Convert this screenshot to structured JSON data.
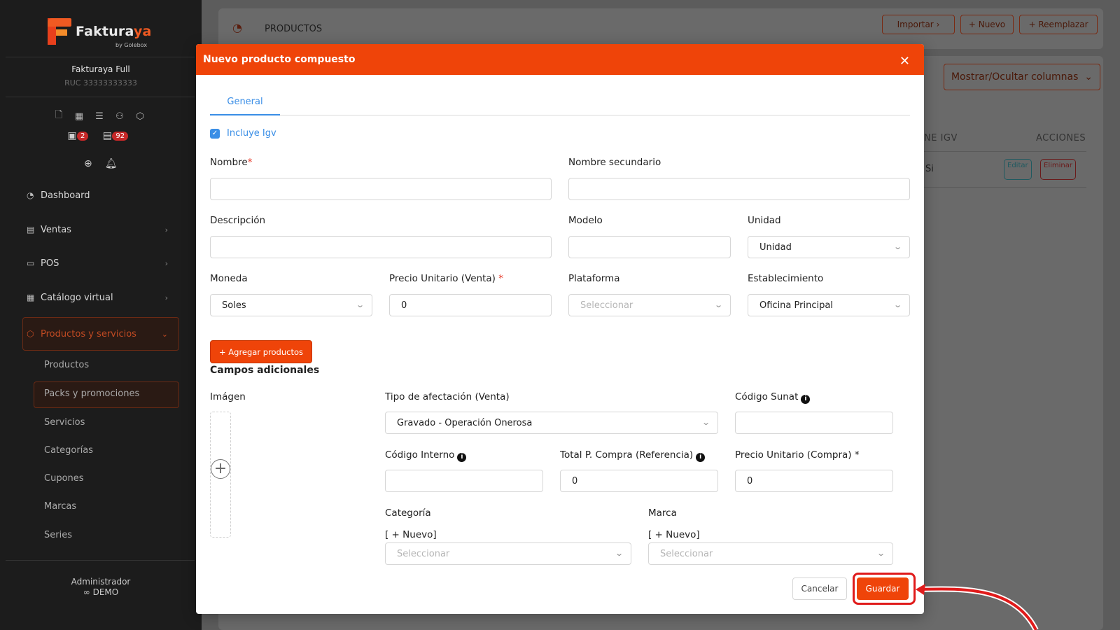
{
  "brand": {
    "name_part1": "Faktura",
    "name_part2": "ya",
    "sub": "by Golebox"
  },
  "company": {
    "name": "Fakturaya Full",
    "ruc": "RUC 33333333333"
  },
  "badges": {
    "calendar_count": "2",
    "boxes_count": "92"
  },
  "nav": {
    "dashboard": "Dashboard",
    "ventas": "Ventas",
    "pos": "POS",
    "catalogo": "Catálogo virtual",
    "productos_servicios": "Productos y servicios",
    "sub": {
      "productos": "Productos",
      "packs": "Packs y promociones",
      "servicios": "Servicios",
      "categorias": "Categorías",
      "cupones": "Cupones",
      "marcas": "Marcas",
      "series": "Series"
    }
  },
  "user": {
    "role": "Administrador",
    "mode": "DEMO"
  },
  "page": {
    "title": "PRODUCTOS",
    "import_label": "Importar",
    "new_label": "+ Nuevo",
    "replace_label": "+ Reemplazar",
    "toggle_columns_label": "Mostrar/Ocultar columnas",
    "th_igv": "NE IGV",
    "th_actions": "ACCIONES",
    "row_igv": "Si",
    "edit_label": "Editar",
    "delete_label": "Eliminar"
  },
  "modal": {
    "title": "Nuevo producto compuesto",
    "tab_general": "General",
    "includes_igv": "Incluye Igv",
    "nombre_label": "Nombre",
    "nombre_sec_label": "Nombre secundario",
    "descripcion_label": "Descripción",
    "modelo_label": "Modelo",
    "unidad_label": "Unidad",
    "unidad_value": "Unidad",
    "moneda_label": "Moneda",
    "moneda_value": "Soles",
    "precio_venta_label": "Precio Unitario (Venta)",
    "precio_venta_value": "0",
    "plataforma_label": "Plataforma",
    "plataforma_placeholder": "Seleccionar",
    "establecimiento_label": "Establecimiento",
    "establecimiento_value": "Oficina Principal",
    "add_products_label": "+ Agregar productos",
    "extra_fields_title": "Campos adicionales",
    "imagen_label": "Imágen",
    "tipo_afectacion_label": "Tipo de afectación (Venta)",
    "tipo_afectacion_value": "Gravado - Operación Onerosa",
    "codigo_sunat_label": "Código Sunat",
    "codigo_interno_label": "Código Interno",
    "total_compra_label": "Total P. Compra (Referencia)",
    "total_compra_value": "0",
    "precio_compra_label": "Precio Unitario (Compra) *",
    "precio_compra_value": "0",
    "categoria_label": "Categoría",
    "categoria_new": "[ + Nuevo]",
    "categoria_placeholder": "Seleccionar",
    "marca_label": "Marca",
    "marca_new": "[ + Nuevo]",
    "marca_placeholder": "Seleccionar",
    "cancel_label": "Cancelar",
    "save_label": "Guardar"
  },
  "colors": {
    "accent": "#ef4409",
    "link": "#3a8ee6",
    "highlight": "#e01b1b"
  }
}
